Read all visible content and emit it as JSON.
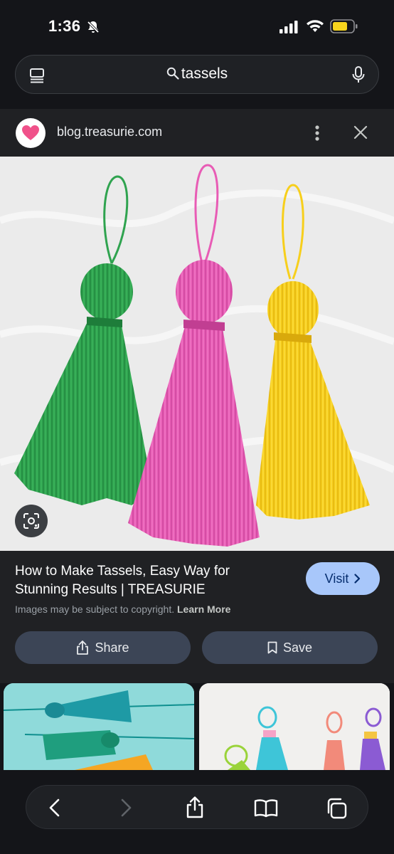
{
  "status_bar": {
    "time": "1:36",
    "silent_mode": true,
    "battery_color": "#f7d51d"
  },
  "search": {
    "query": "tassels"
  },
  "source": {
    "domain": "blog.treasurie.com",
    "favicon": "heart-icon"
  },
  "image": {
    "subject": "green, pink and yellow tassels",
    "colors": [
      "#2fa34f",
      "#e85cb5",
      "#f7cf1c"
    ]
  },
  "result": {
    "title": "How to Make Tassels, Easy Way for Stunning Results | TREASURIE",
    "visit_label": "Visit",
    "copyright_text": "Images may be subject to copyright.",
    "learn_more_label": "Learn More",
    "share_label": "Share",
    "save_label": "Save"
  },
  "thumbnails": [
    {
      "icon": "teal-tassels-thumbnail"
    },
    {
      "icon": "multicolor-tassels-thumbnail"
    }
  ],
  "toolbar": {
    "items": [
      "back-icon",
      "forward-icon",
      "share-icon",
      "bookmarks-icon",
      "tabs-icon"
    ],
    "forward_enabled": false
  }
}
